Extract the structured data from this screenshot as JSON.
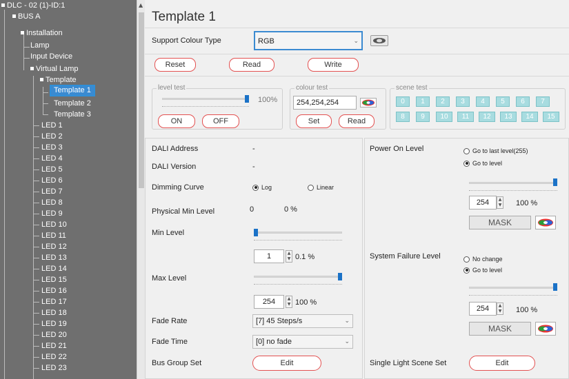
{
  "tree": {
    "root": "DLC - 02 (1)-ID:1",
    "bus": "BUS A",
    "installation": "Installation",
    "lamp": "Lamp",
    "input_device": "Input Device",
    "virtual_lamp": "Virtual Lamp",
    "template": "Template",
    "template_items": [
      "Template 1",
      "Template 2",
      "Template 3"
    ],
    "leds": [
      "LED 1",
      "LED 2",
      "LED 3",
      "LED 4",
      "LED 5",
      "LED 6",
      "LED 7",
      "LED 8",
      "LED 9",
      "LED 10",
      "LED 11",
      "LED 12",
      "LED 13",
      "LED 14",
      "LED 15",
      "LED 16",
      "LED 17",
      "LED 18",
      "LED 19",
      "LED 20",
      "LED 21",
      "LED 22",
      "LED 23"
    ],
    "selected": "Template 1"
  },
  "header": {
    "title": "Template 1",
    "colour_type_label": "Support Colour Type",
    "colour_type_value": "RGB"
  },
  "actions": {
    "reset": "Reset",
    "read": "Read",
    "write": "Write"
  },
  "level_test": {
    "label": "level test",
    "percent": "100%",
    "level": 1.0,
    "on": "ON",
    "off": "OFF"
  },
  "colour_test": {
    "label": "colour test",
    "value": "254,254,254",
    "set": "Set",
    "read": "Read"
  },
  "scene_test": {
    "label": "scene test",
    "scenes": [
      "0",
      "1",
      "2",
      "3",
      "4",
      "5",
      "6",
      "7",
      "8",
      "9",
      "10",
      "11",
      "12",
      "13",
      "14",
      "15"
    ]
  },
  "left_panel": {
    "dali_address_label": "DALI Address",
    "dali_address_value": "-",
    "dali_version_label": "DALI Version",
    "dali_version_value": "-",
    "dimming_curve_label": "Dimming Curve",
    "dimming_log": "Log",
    "dimming_linear": "Linear",
    "phys_min_label": "Physical Min Level",
    "phys_min_value": "0",
    "phys_min_percent": "0 %",
    "min_level_label": "Min Level",
    "min_level_value": "1",
    "min_level_percent": "0.1 %",
    "min_level_fraction": 0.0,
    "max_level_label": "Max Level",
    "max_level_value": "254",
    "max_level_percent": "100 %",
    "max_level_fraction": 1.0,
    "fade_rate_label": "Fade Rate",
    "fade_rate_value": "[7] 45 Steps/s",
    "fade_time_label": "Fade Time",
    "fade_time_value": "[0] no fade",
    "bus_group_label": "Bus Group Set",
    "bus_group_button": "Edit"
  },
  "right_panel": {
    "power_on_label": "Power On Level",
    "power_on_opt1": "Go to last level(255)",
    "power_on_opt2": "Go to level",
    "power_on_value": "254",
    "power_on_percent": "100 %",
    "power_on_fraction": 1.0,
    "mask1": "MASK",
    "sys_fail_label": "System Failure Level",
    "sys_fail_opt1": "No change",
    "sys_fail_opt2": "Go to level",
    "sys_fail_value": "254",
    "sys_fail_percent": "100 %",
    "sys_fail_fraction": 1.0,
    "mask2": "MASK",
    "scene_set_label": "Single Light Scene Set",
    "scene_set_button": "Edit"
  }
}
